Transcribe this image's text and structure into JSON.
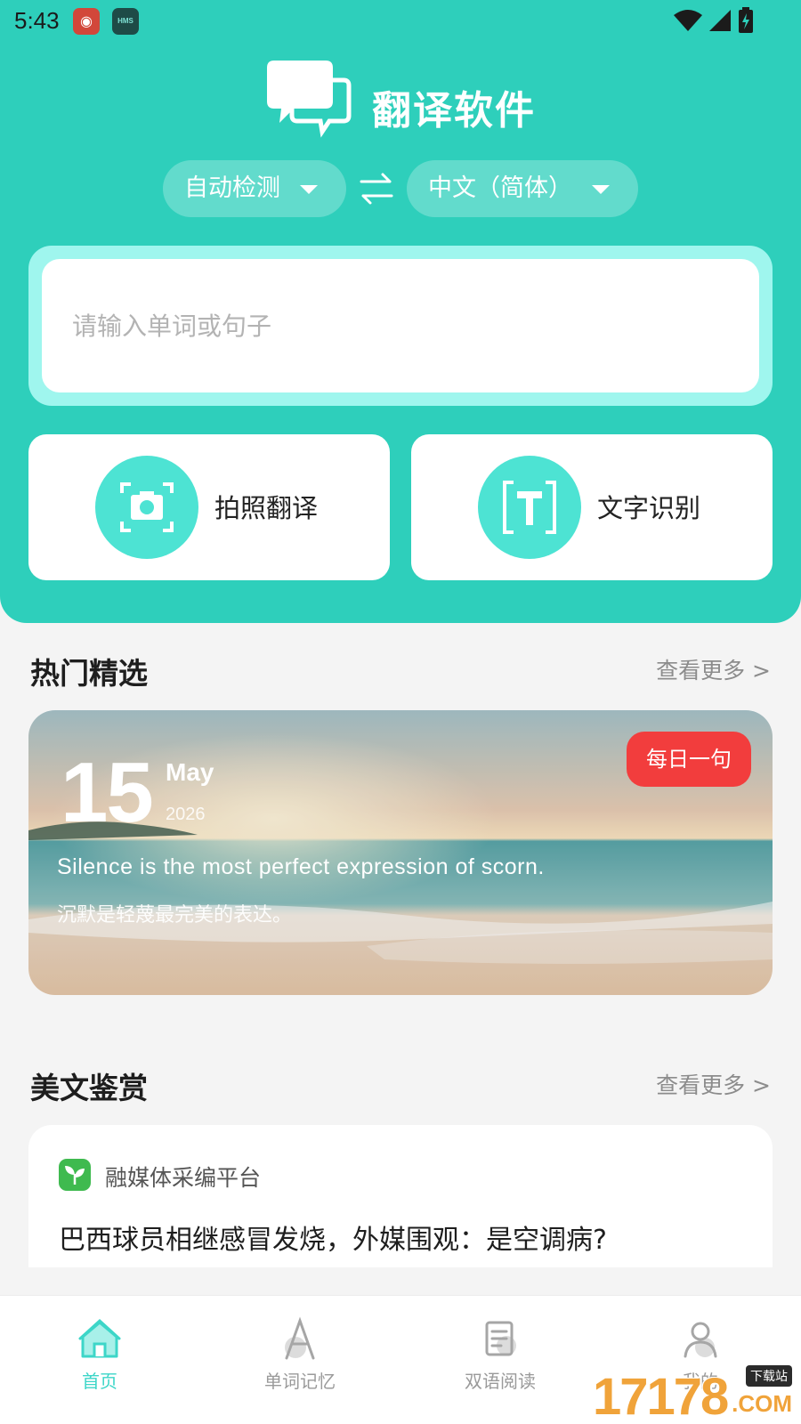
{
  "status_bar": {
    "time": "5:43",
    "app_badge_2": "HMS",
    "icons": [
      "weather-app-icon",
      "hms-icon",
      "wifi-icon",
      "cell-signal-icon",
      "battery-icon"
    ]
  },
  "header": {
    "app_title": "翻译软件",
    "source_lang": "自动检测",
    "target_lang": "中文（简体）",
    "input_placeholder": "请输入单词或句子",
    "accent_color": "#2ecfbb"
  },
  "tools": [
    {
      "label": "拍照翻译",
      "icon": "camera-scan-icon"
    },
    {
      "label": "文字识别",
      "icon": "text-scan-icon"
    }
  ],
  "hot": {
    "title": "热门精选",
    "more": "查看更多 >",
    "daily": {
      "day": "15",
      "month": "May",
      "year": "2026",
      "badge": "每日一句",
      "quote_en": "Silence is the most perfect expression of scorn.",
      "quote_cn": "沉默是轻蔑最完美的表达。"
    }
  },
  "articles": {
    "title": "美文鉴赏",
    "more": "查看更多 >",
    "items": [
      {
        "source": "融媒体采编平台",
        "headline": "巴西球员相继感冒发烧，外媒围观：是空调病?"
      }
    ]
  },
  "bottom_nav": [
    {
      "label": "首页",
      "icon": "home-icon",
      "active": true
    },
    {
      "label": "单词记忆",
      "icon": "letter-a-icon",
      "active": false
    },
    {
      "label": "双语阅读",
      "icon": "reading-icon",
      "active": false
    },
    {
      "label": "我的",
      "icon": "profile-icon",
      "active": false
    }
  ],
  "watermark": {
    "number": "17178",
    "tag": "下载站",
    "suffix": ".COM"
  }
}
